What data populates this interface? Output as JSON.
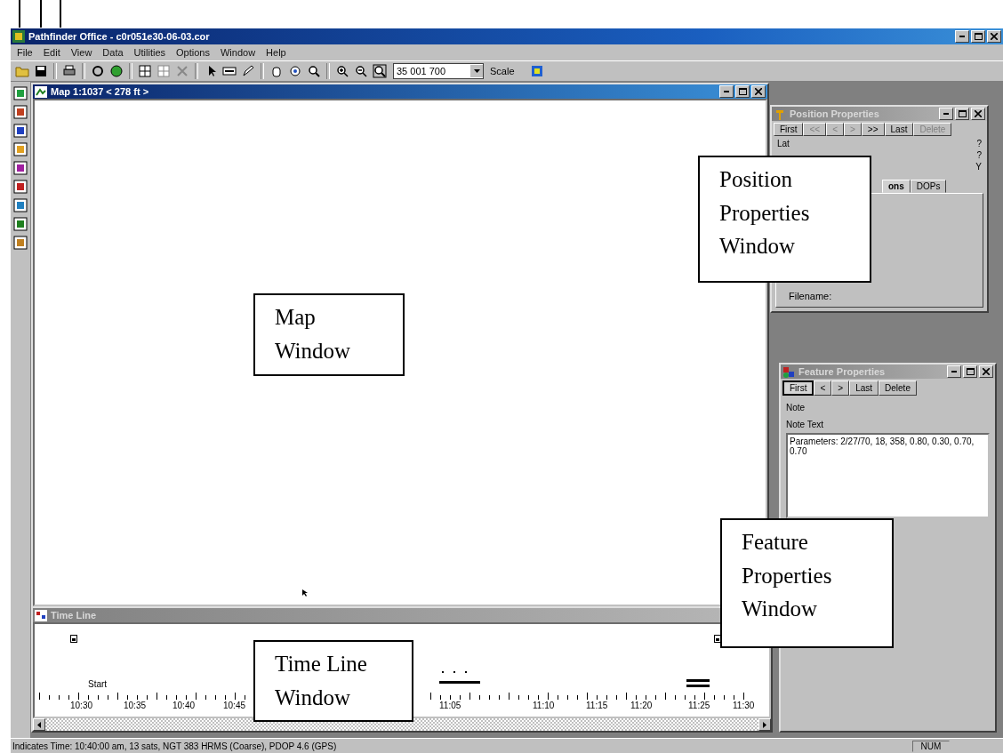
{
  "window": {
    "title": "Pathfinder Office - c0r051e30-06-03.cor"
  },
  "menu": [
    "File",
    "Edit",
    "View",
    "Data",
    "Utilities",
    "Options",
    "Window",
    "Help"
  ],
  "toolbar": {
    "scale_value": "35 001 700",
    "scale_label": "Scale"
  },
  "map_window": {
    "title": "Map 1:1037 < 278 ft >"
  },
  "position_properties": {
    "title": "Position Properties",
    "buttons": [
      {
        "label": "First",
        "disabled": false
      },
      {
        "label": "<<",
        "disabled": true
      },
      {
        "label": "<",
        "disabled": true
      },
      {
        "label": ">",
        "disabled": true
      },
      {
        "label": ">>",
        "disabled": false
      },
      {
        "label": "Last",
        "disabled": false
      },
      {
        "label": "Delete",
        "disabled": true
      }
    ],
    "label": "Lat",
    "values": [
      "?",
      "?",
      "Y"
    ],
    "tabs": [
      {
        "label": "ons",
        "selected": true
      },
      {
        "label": "DOPs",
        "selected": false
      }
    ],
    "filename_label": "Filename:"
  },
  "feature_properties": {
    "title": "Feature Properties",
    "buttons": [
      {
        "label": "First",
        "selected": true
      },
      {
        "label": "<",
        "selected": false
      },
      {
        "label": ">",
        "selected": false
      },
      {
        "label": "Last",
        "selected": false
      },
      {
        "label": "Delete",
        "selected": false
      }
    ],
    "fields": [
      "Note",
      "Note Text"
    ],
    "note_text": "Parameters: 2/27/70, 18, 358, 0.80, 0.30, 0.70, 0.70"
  },
  "time_line": {
    "title": "Time Line",
    "start_label": "Start",
    "ticks": [
      "10:30",
      "10:35",
      "10:40",
      "10:45",
      "11:05",
      "11:10",
      "11:15",
      "11:20",
      "11:25",
      "11:30"
    ]
  },
  "status_bar": {
    "text": "Indicates Time: 10:40:00 am, 13 sats, NGT 383 HRMS (Coarse), PDOP 4.6 (GPS)",
    "indicator": "NUM"
  },
  "callouts": [
    "Position Properties Window",
    "Map Window",
    "Time Line Window",
    "Feature Properties Window"
  ]
}
